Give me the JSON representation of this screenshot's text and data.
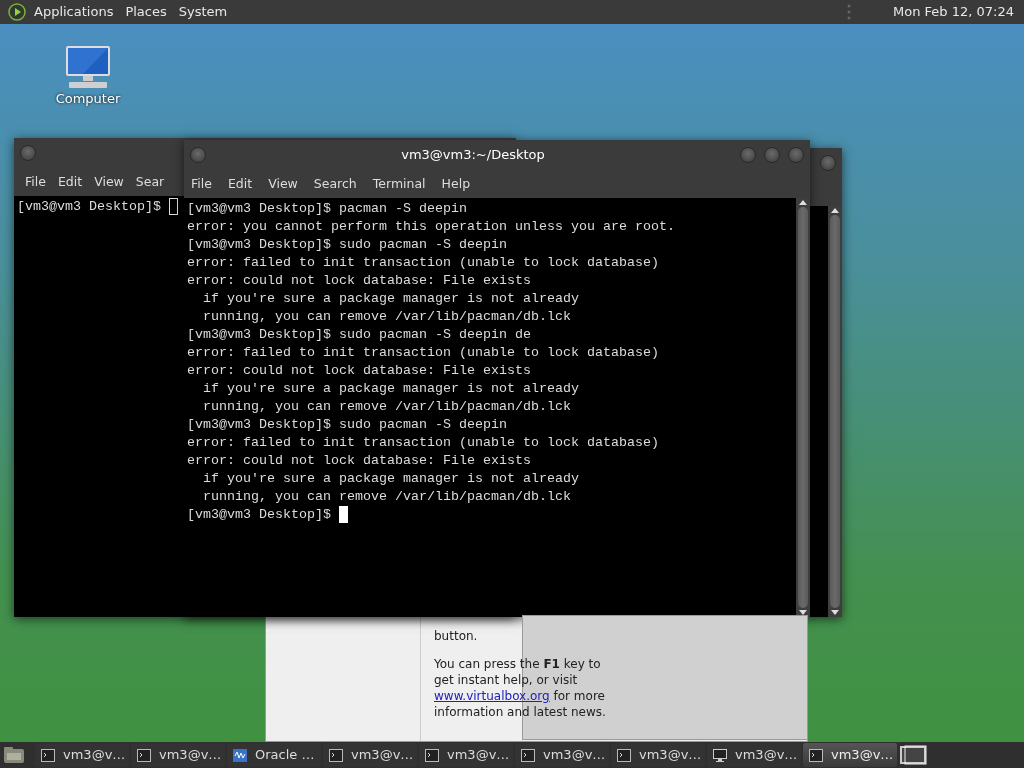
{
  "top_panel": {
    "menus": [
      "Applications",
      "Places",
      "System"
    ],
    "clock": "Mon Feb 12, 07:24"
  },
  "desktop_icons": [
    {
      "label": "Computer"
    }
  ],
  "virtualbox_window": {
    "paragraphs": [
      {
        "text": "button."
      },
      {
        "text": "You can press the **F1** key to get instant help, or visit",
        "link": "www.virtualbox.org",
        "after": "for more information and latest news."
      }
    ]
  },
  "back_terminal": {
    "menus": [
      "File",
      "Edit",
      "View",
      "Sear"
    ],
    "prompt": "[vm3@vm3 Desktop]$"
  },
  "front_terminal": {
    "title": "vm3@vm3:~/Desktop",
    "menus": [
      "File",
      "Edit",
      "View",
      "Search",
      "Terminal",
      "Help"
    ],
    "lines": [
      "[vm3@vm3 Desktop]$ pacman -S deepin",
      "error: you cannot perform this operation unless you are root.",
      "[vm3@vm3 Desktop]$ sudo pacman -S deepin",
      "error: failed to init transaction (unable to lock database)",
      "error: could not lock database: File exists",
      "  if you're sure a package manager is not already",
      "  running, you can remove /var/lib/pacman/db.lck",
      "[vm3@vm3 Desktop]$ sudo pacman -S deepin de",
      "error: failed to init transaction (unable to lock database)",
      "error: could not lock database: File exists",
      "  if you're sure a package manager is not already",
      "  running, you can remove /var/lib/pacman/db.lck",
      "[vm3@vm3 Desktop]$ sudo pacman -S deepin",
      "error: failed to init transaction (unable to lock database)",
      "error: could not lock database: File exists",
      "  if you're sure a package manager is not already",
      "  running, you can remove /var/lib/pacman/db.lck"
    ],
    "prompt": "[vm3@vm3 Desktop]$"
  },
  "taskbar": {
    "tasks": [
      {
        "label": "vm3@v…",
        "kind": "terminal",
        "selected": false
      },
      {
        "label": "vm3@v…",
        "kind": "terminal",
        "selected": false
      },
      {
        "label": "Oracle …",
        "kind": "virtualbox",
        "selected": false
      },
      {
        "label": "vm3@v…",
        "kind": "terminal",
        "selected": false
      },
      {
        "label": "vm3@v…",
        "kind": "terminal",
        "selected": false
      },
      {
        "label": "vm3@v…",
        "kind": "terminal",
        "selected": false
      },
      {
        "label": "vm3@v…",
        "kind": "terminal",
        "selected": false
      },
      {
        "label": "vm3@v…",
        "kind": "monitor",
        "selected": false
      },
      {
        "label": "vm3@v…",
        "kind": "terminal",
        "selected": true
      }
    ]
  }
}
